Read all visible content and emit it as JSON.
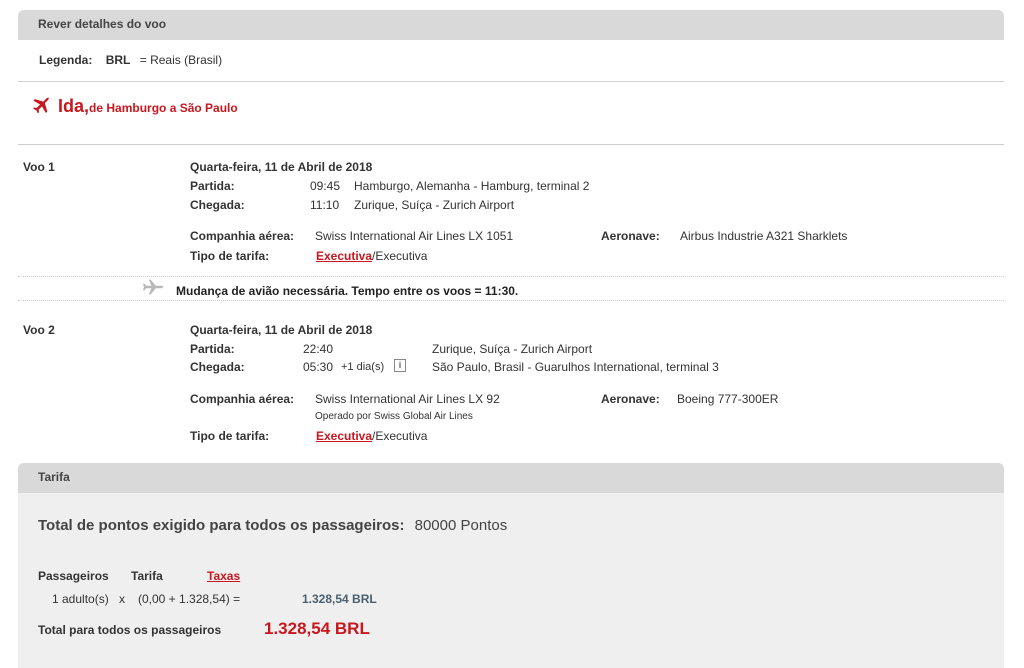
{
  "review": {
    "title": "Rever detalhes do voo"
  },
  "legend": {
    "label": "Legenda:",
    "code": "BRL",
    "eq": "=",
    "desc": "Reais (Brasil)"
  },
  "direction": {
    "label": "Ida,",
    "route": "de Hamburgo a São Paulo"
  },
  "flights": [
    {
      "label": "Voo 1",
      "date": "Quarta-feira, 11 de Abril de 2018",
      "departure_label": "Partida:",
      "departure_time": "09:45",
      "departure_place": "Hamburgo, Alemanha - Hamburg, terminal 2",
      "arrival_label": "Chegada:",
      "arrival_time": "11:10",
      "arrival_place": "Zurique, Suíça - Zurich Airport",
      "airline_label": "Companhia aérea:",
      "airline": "Swiss International Air Lines LX 1051",
      "aircraft_label": "Aeronave:",
      "aircraft": "Airbus Industrie A321 Sharklets",
      "fare_label": "Tipo de tarifa:",
      "fare_link": "Executiva",
      "fare_rest": "/Executiva"
    },
    {
      "label": "Voo 2",
      "date": "Quarta-feira, 11 de Abril de 2018",
      "departure_label": "Partida:",
      "departure_time": "22:40",
      "departure_place": "Zurique, Suíça - Zurich Airport",
      "arrival_label": "Chegada:",
      "arrival_time": "05:30",
      "arrival_extra": "+1 dia(s)",
      "arrival_place": "São Paulo, Brasil - Guarulhos International, terminal 3",
      "airline_label": "Companhia aérea:",
      "airline": "Swiss International Air Lines LX 92",
      "operated_by": "Operado por Swiss Global Air Lines",
      "aircraft_label": "Aeronave:",
      "aircraft": "Boeing 777-300ER",
      "fare_label": "Tipo de tarifa:",
      "fare_link": "Executiva",
      "fare_rest": "/Executiva"
    }
  ],
  "connection_note": "Mudança de avião necessária. Tempo entre os voos = 11:30.",
  "fare": {
    "title": "Tarifa",
    "total_points_label": "Total de pontos exigido para todos os passageiros:",
    "total_points_value": "80000 Pontos",
    "col_passengers": "Passageiros",
    "col_fare": "Tarifa",
    "col_taxes": "Taxas",
    "row_passengers": "1 adulto(s)",
    "row_x": "x",
    "row_calc": "(0,00 + 1.328,54) =",
    "row_total": "1.328,54 BRL",
    "grand_label": "Total para todos os passageiros",
    "grand_value": "1.328,54 BRL"
  },
  "colors": {
    "accent_red": "#c8171e",
    "header_grey": "#d9d9d9",
    "panel_grey": "#efefef"
  }
}
